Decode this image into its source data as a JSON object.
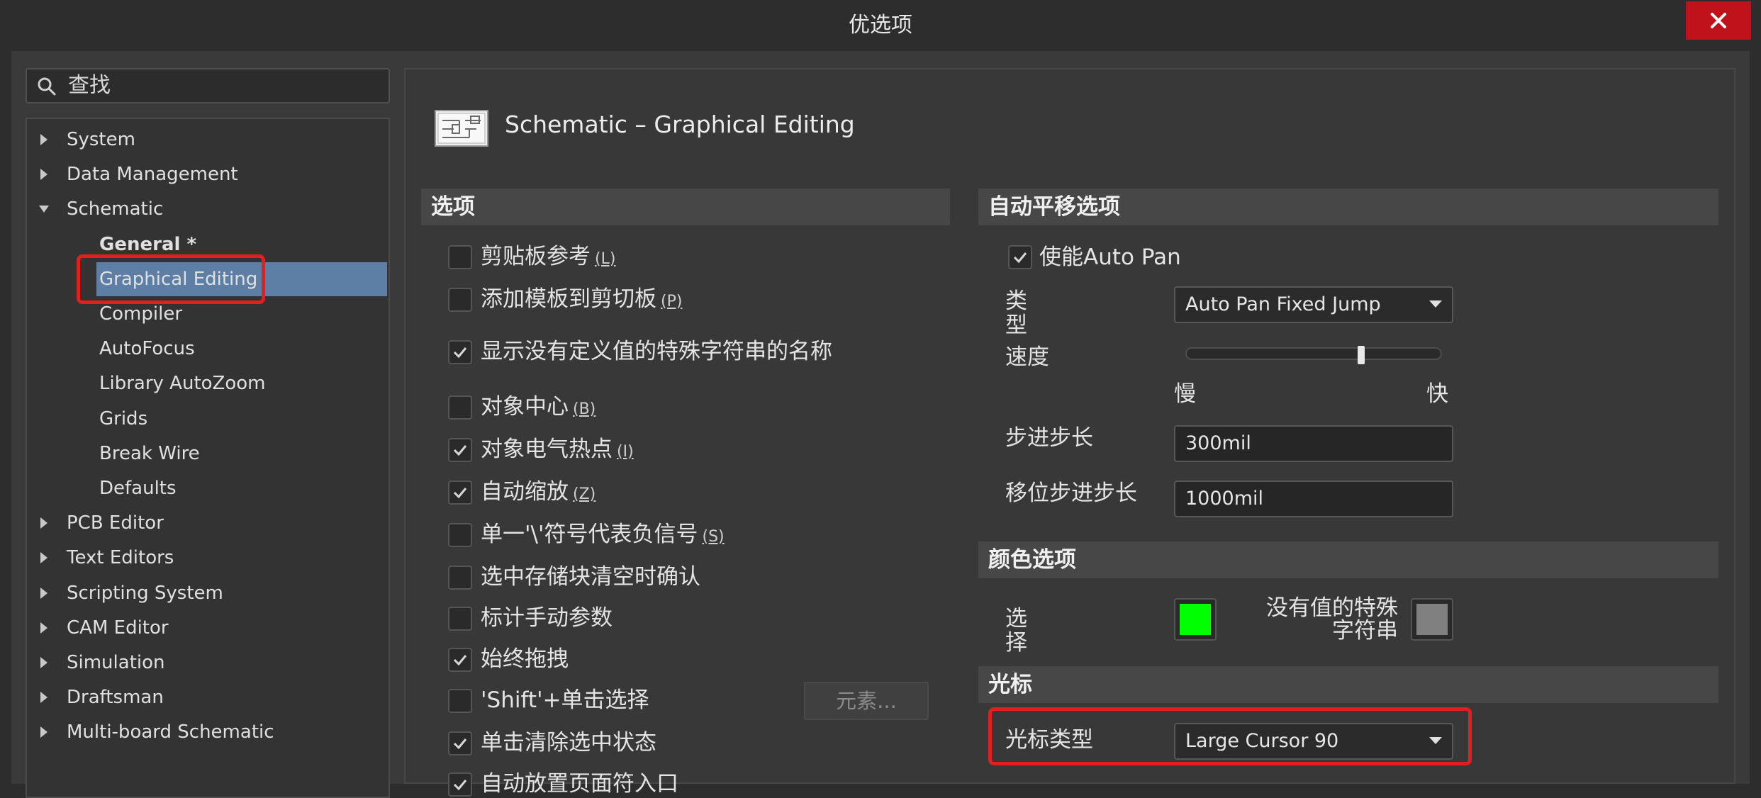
{
  "window": {
    "title": "优选项",
    "close_label": "✕"
  },
  "search": {
    "placeholder": "查找"
  },
  "tree": {
    "items": [
      {
        "label": "System",
        "level": 0,
        "arrow": "right"
      },
      {
        "label": "Data Management",
        "level": 0,
        "arrow": "right"
      },
      {
        "label": "Schematic",
        "level": 0,
        "arrow": "down"
      },
      {
        "label": "General *",
        "level": 1,
        "bold": true
      },
      {
        "label": "Graphical Editing",
        "level": 1,
        "selected": true
      },
      {
        "label": "Compiler",
        "level": 1
      },
      {
        "label": "AutoFocus",
        "level": 1
      },
      {
        "label": "Library AutoZoom",
        "level": 1
      },
      {
        "label": "Grids",
        "level": 1
      },
      {
        "label": "Break Wire",
        "level": 1
      },
      {
        "label": "Defaults",
        "level": 1
      },
      {
        "label": "PCB Editor",
        "level": 0,
        "arrow": "right"
      },
      {
        "label": "Text Editors",
        "level": 0,
        "arrow": "right"
      },
      {
        "label": "Scripting System",
        "level": 0,
        "arrow": "right"
      },
      {
        "label": "CAM Editor",
        "level": 0,
        "arrow": "right"
      },
      {
        "label": "Simulation",
        "level": 0,
        "arrow": "right"
      },
      {
        "label": "Draftsman",
        "level": 0,
        "arrow": "right"
      },
      {
        "label": "Multi-board Schematic",
        "level": 0,
        "arrow": "right"
      }
    ]
  },
  "header": {
    "title": "Schematic – Graphical Editing",
    "icon": "schematic-icon"
  },
  "options": {
    "section_title": "选项",
    "items": [
      {
        "label": "剪贴板参考",
        "hotkey": "(L)",
        "checked": false
      },
      {
        "label": "添加模板到剪切板",
        "hotkey": "(P)",
        "checked": false
      },
      {
        "label": "显示没有定义值的特殊字符串的名称",
        "hotkey": "",
        "checked": true
      },
      {
        "label": "对象中心",
        "hotkey": "(B)",
        "checked": false
      },
      {
        "label": "对象电气热点",
        "hotkey": "(I)",
        "checked": true
      },
      {
        "label": "自动缩放",
        "hotkey": "(Z)",
        "checked": true
      },
      {
        "label": "单一'\\'符号代表负信号",
        "hotkey": "(S)",
        "checked": false
      },
      {
        "label": "选中存储块清空时确认",
        "hotkey": "",
        "checked": false
      },
      {
        "label": "标计手动参数",
        "hotkey": "",
        "checked": false
      },
      {
        "label": "始终拖拽",
        "hotkey": "",
        "checked": true
      },
      {
        "label": "'Shift'+单击选择",
        "hotkey": "",
        "checked": false
      },
      {
        "label": "单击清除选中状态",
        "hotkey": "",
        "checked": true
      },
      {
        "label": "自动放置页面符入口",
        "hotkey": "",
        "checked": true
      }
    ],
    "elements_button": "元素..."
  },
  "autopan": {
    "section_title": "自动平移选项",
    "enable_label": "使能Auto Pan",
    "enable_checked": true,
    "type_label": "类型",
    "type_value": "Auto Pan Fixed Jump",
    "speed_label": "速度",
    "speed_value": 0.7,
    "slow_label": "慢",
    "fast_label": "快",
    "step_label": "步进步长",
    "step_value": "300mil",
    "shift_step_label": "移位步进步长",
    "shift_step_value": "1000mil"
  },
  "colors": {
    "section_title": "颜色选项",
    "selection_label": "选择",
    "selection_color": "#00ff00",
    "special_label_line1": "没有值的特殊",
    "special_label_line2": "字符串",
    "special_color": "#808080"
  },
  "cursor": {
    "section_title": "光标",
    "type_label": "光标类型",
    "type_value": "Large Cursor 90"
  },
  "accent": {
    "selection": "#5d7fa6",
    "close": "#c0121a",
    "highlight": "#e41d1d"
  }
}
